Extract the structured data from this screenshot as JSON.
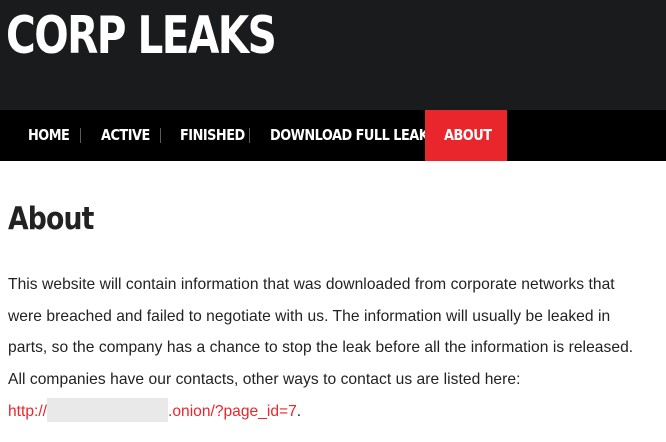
{
  "header": {
    "logo": "CORP LEAKS"
  },
  "nav": {
    "items": [
      {
        "label": "HOME"
      },
      {
        "label": "ACTIVE"
      },
      {
        "label": "FINISHED"
      },
      {
        "label": "DOWNLOAD FULL LEAKS"
      },
      {
        "label": "ABOUT"
      }
    ],
    "active_color": "#e8262b"
  },
  "main": {
    "title": "About",
    "paragraph_lines": [
      "This website will contain information that was downloaded from corporate networks that",
      "were breached and failed to negotiate with us. The information will usually be leaked in",
      "parts, so the company has a chance to stop the leak before all the information is released.",
      "All companies have our contacts, other ways to contact us are listed here:"
    ],
    "link": {
      "prefix": "http://",
      "suffix": ".onion/?page_id=7",
      "trailing": "."
    }
  },
  "colors": {
    "header_bg": "#1a1b1d",
    "nav_bg": "#000000",
    "accent": "#e8262b"
  }
}
